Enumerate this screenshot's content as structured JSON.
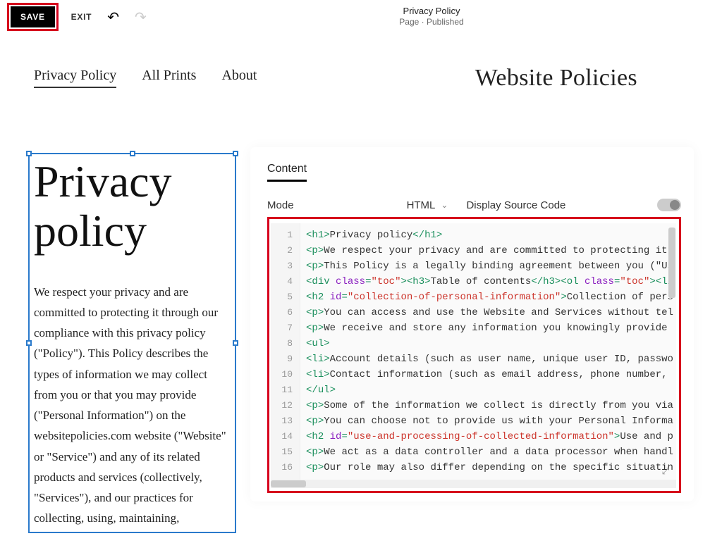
{
  "toolbar": {
    "save_label": "SAVE",
    "exit_label": "EXIT"
  },
  "page_meta": {
    "title": "Privacy Policy",
    "status": "Page · Published"
  },
  "nav": {
    "items": [
      "Privacy Policy",
      "All Prints",
      "About"
    ],
    "site_title": "Website Policies"
  },
  "preview": {
    "heading": "Privacy policy",
    "body": "We respect your privacy and are committed to protecting it through our compliance with this privacy policy (\"Policy\"). This Policy describes the types of information we may collect from you or that you may provide (\"Personal Information\") on the websitepolicies.com website (\"Website\" or \"Service\") and any of its related products and services (collectively, \"Services\"), and our practices for collecting, using, maintaining,"
  },
  "panel": {
    "tab_label": "Content",
    "mode_label": "Mode",
    "mode_value": "HTML",
    "display_source_label": "Display Source Code"
  },
  "code": {
    "lines": [
      {
        "n": 1,
        "segs": [
          {
            "c": "t-tag",
            "t": "<h1>"
          },
          {
            "c": "t-txt",
            "t": "Privacy policy"
          },
          {
            "c": "t-tag",
            "t": "</h1>"
          }
        ]
      },
      {
        "n": 2,
        "segs": [
          {
            "c": "t-tag",
            "t": "<p>"
          },
          {
            "c": "t-txt",
            "t": "We respect your privacy and are committed to protecting it"
          }
        ]
      },
      {
        "n": 3,
        "segs": [
          {
            "c": "t-tag",
            "t": "<p>"
          },
          {
            "c": "t-txt",
            "t": "This Policy is a legally binding agreement between you (\"Us"
          }
        ]
      },
      {
        "n": 4,
        "segs": [
          {
            "c": "t-tag",
            "t": "<div "
          },
          {
            "c": "t-attr",
            "t": "class"
          },
          {
            "c": "t-tag",
            "t": "="
          },
          {
            "c": "t-str",
            "t": "\"toc\""
          },
          {
            "c": "t-tag",
            "t": "><h3>"
          },
          {
            "c": "t-txt",
            "t": "Table of contents"
          },
          {
            "c": "t-tag",
            "t": "</h3><ol "
          },
          {
            "c": "t-attr",
            "t": "class"
          },
          {
            "c": "t-tag",
            "t": "="
          },
          {
            "c": "t-str",
            "t": "\"toc\""
          },
          {
            "c": "t-tag",
            "t": "><li"
          }
        ]
      },
      {
        "n": 5,
        "segs": [
          {
            "c": "t-tag",
            "t": "<h2 "
          },
          {
            "c": "t-attr",
            "t": "id"
          },
          {
            "c": "t-tag",
            "t": "="
          },
          {
            "c": "t-str",
            "t": "\"collection-of-personal-information\""
          },
          {
            "c": "t-tag",
            "t": ">"
          },
          {
            "c": "t-txt",
            "t": "Collection of pers"
          }
        ]
      },
      {
        "n": 6,
        "segs": [
          {
            "c": "t-tag",
            "t": "<p>"
          },
          {
            "c": "t-txt",
            "t": "You can access and use the Website and Services without tel"
          }
        ]
      },
      {
        "n": 7,
        "segs": [
          {
            "c": "t-tag",
            "t": "<p>"
          },
          {
            "c": "t-txt",
            "t": "We receive and store any information you knowingly provide"
          }
        ]
      },
      {
        "n": 8,
        "segs": [
          {
            "c": "t-tag",
            "t": "<ul>"
          }
        ]
      },
      {
        "n": 9,
        "segs": [
          {
            "c": "t-tag",
            "t": "<li>"
          },
          {
            "c": "t-txt",
            "t": "Account details (such as user name, unique user ID, passwo"
          }
        ]
      },
      {
        "n": 10,
        "segs": [
          {
            "c": "t-tag",
            "t": "<li>"
          },
          {
            "c": "t-txt",
            "t": "Contact information (such as email address, phone number,"
          }
        ]
      },
      {
        "n": 11,
        "segs": [
          {
            "c": "t-tag",
            "t": "</ul>"
          }
        ]
      },
      {
        "n": 12,
        "segs": [
          {
            "c": "t-tag",
            "t": "<p>"
          },
          {
            "c": "t-txt",
            "t": "Some of the information we collect is directly from you via"
          }
        ]
      },
      {
        "n": 13,
        "segs": [
          {
            "c": "t-tag",
            "t": "<p>"
          },
          {
            "c": "t-txt",
            "t": "You can choose not to provide us with your Personal Informa"
          }
        ]
      },
      {
        "n": 14,
        "segs": [
          {
            "c": "t-tag",
            "t": "<h2 "
          },
          {
            "c": "t-attr",
            "t": "id"
          },
          {
            "c": "t-tag",
            "t": "="
          },
          {
            "c": "t-str",
            "t": "\"use-and-processing-of-collected-information\""
          },
          {
            "c": "t-tag",
            "t": ">"
          },
          {
            "c": "t-txt",
            "t": "Use and p"
          }
        ]
      },
      {
        "n": 15,
        "segs": [
          {
            "c": "t-tag",
            "t": "<p>"
          },
          {
            "c": "t-txt",
            "t": "We act as a data controller and a data processor when handl"
          }
        ]
      },
      {
        "n": 16,
        "segs": [
          {
            "c": "t-tag",
            "t": "<p>"
          },
          {
            "c": "t-txt",
            "t": "Our role may also differ depending on the specific situatin"
          }
        ]
      }
    ]
  }
}
